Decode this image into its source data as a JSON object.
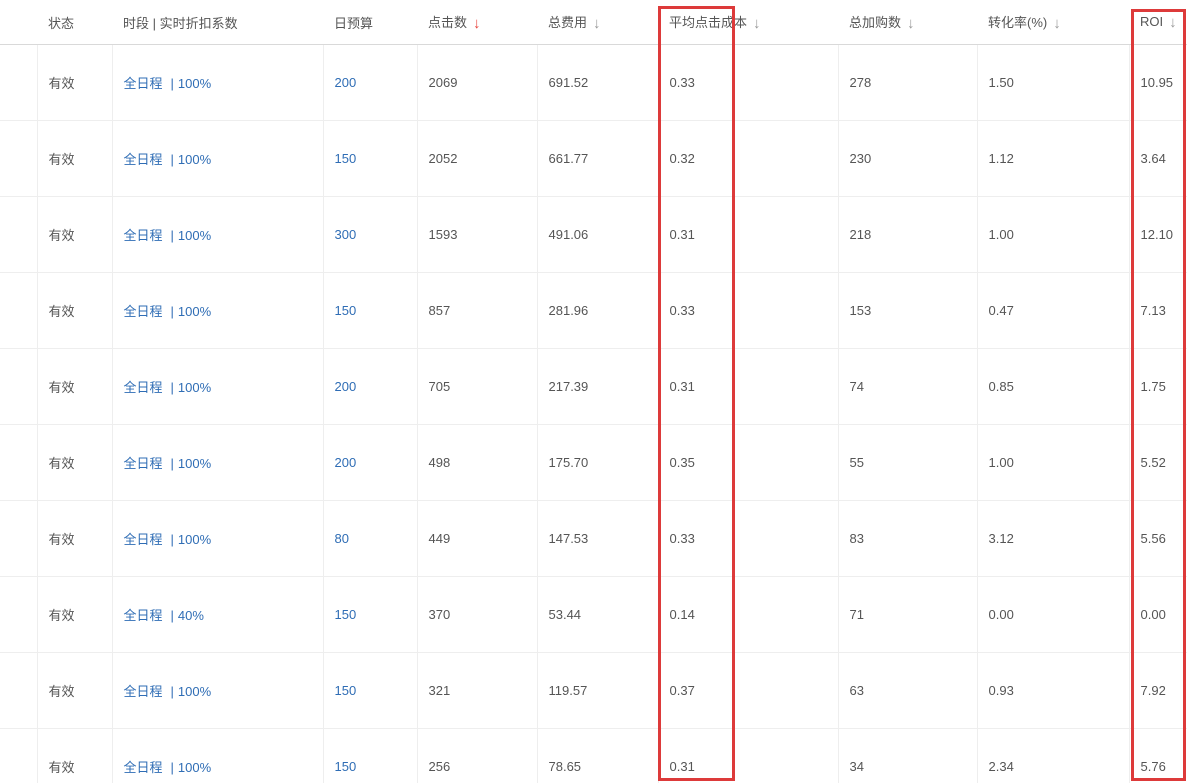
{
  "table": {
    "headers": {
      "status": "状态",
      "schedule": "时段 | 实时折扣系数",
      "budget": "日预算",
      "clicks": "点击数",
      "cost": "总费用",
      "cpc": "平均点击成本",
      "cart_adds": "总加购数",
      "conversion_rate": "转化率(%)",
      "roi": "ROI"
    },
    "sort_arrow": "↓",
    "active_sort_column": "clicks",
    "schedule_separator": "|",
    "rows": [
      {
        "status": "有效",
        "schedule": "全日程",
        "discount": "100%",
        "budget": "200",
        "clicks": "2069",
        "cost": "691.52",
        "cpc": "0.33",
        "cart_adds": "278",
        "conversion_rate": "1.50",
        "roi": "10.95"
      },
      {
        "status": "有效",
        "schedule": "全日程",
        "discount": "100%",
        "budget": "150",
        "clicks": "2052",
        "cost": "661.77",
        "cpc": "0.32",
        "cart_adds": "230",
        "conversion_rate": "1.12",
        "roi": "3.64"
      },
      {
        "status": "有效",
        "schedule": "全日程",
        "discount": "100%",
        "budget": "300",
        "clicks": "1593",
        "cost": "491.06",
        "cpc": "0.31",
        "cart_adds": "218",
        "conversion_rate": "1.00",
        "roi": "12.10"
      },
      {
        "status": "有效",
        "schedule": "全日程",
        "discount": "100%",
        "budget": "150",
        "clicks": "857",
        "cost": "281.96",
        "cpc": "0.33",
        "cart_adds": "153",
        "conversion_rate": "0.47",
        "roi": "7.13"
      },
      {
        "status": "有效",
        "schedule": "全日程",
        "discount": "100%",
        "budget": "200",
        "clicks": "705",
        "cost": "217.39",
        "cpc": "0.31",
        "cart_adds": "74",
        "conversion_rate": "0.85",
        "roi": "1.75"
      },
      {
        "status": "有效",
        "schedule": "全日程",
        "discount": "100%",
        "budget": "200",
        "clicks": "498",
        "cost": "175.70",
        "cpc": "0.35",
        "cart_adds": "55",
        "conversion_rate": "1.00",
        "roi": "5.52"
      },
      {
        "status": "有效",
        "schedule": "全日程",
        "discount": "100%",
        "budget": "80",
        "clicks": "449",
        "cost": "147.53",
        "cpc": "0.33",
        "cart_adds": "83",
        "conversion_rate": "3.12",
        "roi": "5.56"
      },
      {
        "status": "有效",
        "schedule": "全日程",
        "discount": "40%",
        "budget": "150",
        "clicks": "370",
        "cost": "53.44",
        "cpc": "0.14",
        "cart_adds": "71",
        "conversion_rate": "0.00",
        "roi": "0.00"
      },
      {
        "status": "有效",
        "schedule": "全日程",
        "discount": "100%",
        "budget": "150",
        "clicks": "321",
        "cost": "119.57",
        "cpc": "0.37",
        "cart_adds": "63",
        "conversion_rate": "0.93",
        "roi": "7.92"
      },
      {
        "status": "有效",
        "schedule": "全日程",
        "discount": "100%",
        "budget": "150",
        "clicks": "256",
        "cost": "78.65",
        "cpc": "0.31",
        "cart_adds": "34",
        "conversion_rate": "2.34",
        "roi": "5.76"
      }
    ]
  },
  "colors": {
    "link": "#2f6db5",
    "active_sort": "#e8463f",
    "inactive_sort": "#9a9a9a",
    "highlight_box": "#dd3a3a"
  },
  "annotations": [
    "cpc-column-highlight",
    "roi-column-highlight"
  ]
}
